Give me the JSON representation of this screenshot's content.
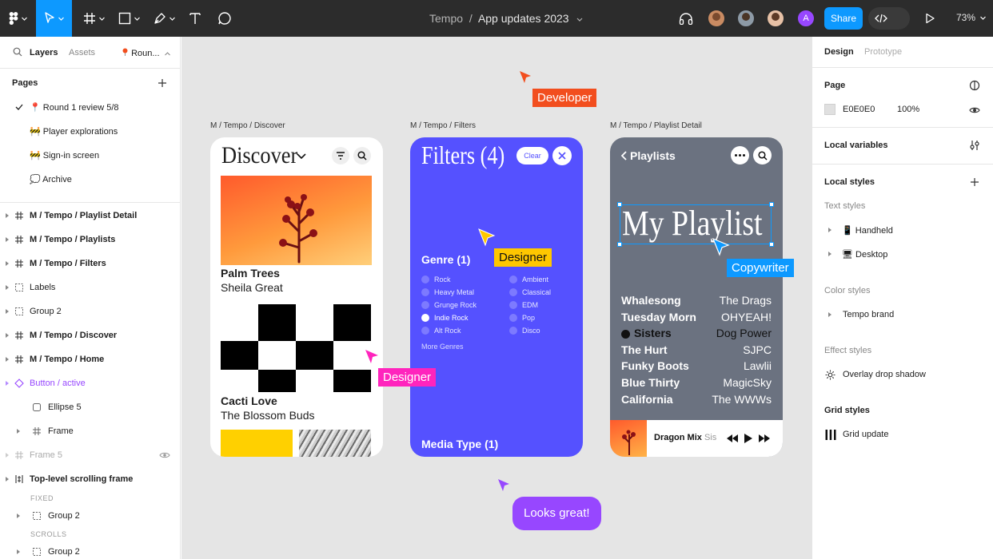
{
  "toolbar": {
    "file_name": "App updates 2023",
    "project": "Tempo",
    "separator": "/",
    "share_label": "Share",
    "zoom": "73%",
    "avatar_letter": "A"
  },
  "left_panel": {
    "tabs": [
      "Layers",
      "Assets",
      "Roun..."
    ],
    "pages_heading": "Pages",
    "pages": [
      "📍 Round 1 review 5/8",
      "🚧 Player explorations",
      "🚧 Sign-in screen",
      "💭 Archive"
    ],
    "layers": [
      "M / Tempo / Playlist Detail",
      "M / Tempo / Playlists",
      "M / Tempo / Filters",
      "Labels",
      "Group 2",
      "M / Tempo / Discover",
      "M / Tempo / Home",
      "Button / active",
      "Ellipse 5",
      "Frame",
      "Frame 5",
      "Top-level scrolling frame",
      "FIXED",
      "Group 2",
      "SCROLLS",
      "Group 2"
    ]
  },
  "canvas": {
    "frame_labels": [
      "M / Tempo / Discover",
      "M / Tempo / Filters",
      "M / Tempo / Playlist Detail"
    ],
    "discover": {
      "title": "Discover",
      "card1_title": "Palm Trees",
      "card1_artist": "Sheila Great",
      "card2_title": "Cacti Love",
      "card2_artist": "The Blossom Buds"
    },
    "filters": {
      "title": "Filters (4)",
      "clear": "Clear",
      "genre_heading": "Genre (1)",
      "genres_left": [
        "Rock",
        "Heavy Metal",
        "Grunge Rock",
        "Indie Rock",
        "Alt Rock"
      ],
      "genres_right": [
        "Ambient",
        "Classical",
        "EDM",
        "Pop",
        "Disco"
      ],
      "more": "More Genres",
      "media_type": "Media Type (1)"
    },
    "playlist": {
      "back": "Playlists",
      "title": "My Playlist",
      "tracks": [
        {
          "song": "Whalesong",
          "artist": "The Drags"
        },
        {
          "song": "Tuesday Morn",
          "artist": "OHYEAH!"
        },
        {
          "song": "Sisters",
          "artist": "Dog Power"
        },
        {
          "song": "The Hurt",
          "artist": "SJPC"
        },
        {
          "song": "Funky Boots",
          "artist": "Lawlii"
        },
        {
          "song": "Blue Thirty",
          "artist": "MagicSky"
        },
        {
          "song": "California",
          "artist": "The WWWs"
        }
      ],
      "now_playing": "Dragon Mix",
      "now_playing_sub": "Sist"
    },
    "cursors": {
      "developer": "Developer",
      "designer_a": "Designer",
      "designer_b": "Designer",
      "copywriter": "Copywriter",
      "comment": "Looks great!"
    }
  },
  "right_panel": {
    "tabs": [
      "Design",
      "Prototype"
    ],
    "page_heading": "Page",
    "page_color": "E0E0E0",
    "page_opacity": "100%",
    "local_variables": "Local variables",
    "local_styles": "Local styles",
    "text_styles": "Text styles",
    "text_style_items": [
      "📱 Handheld",
      "🖥 Desktop"
    ],
    "color_styles": "Color styles",
    "color_style_items": [
      "Tempo brand"
    ],
    "effect_styles": "Effect styles",
    "effect_style_items": [
      "Overlay drop shadow"
    ],
    "grid_styles": "Grid styles",
    "grid_style_items": [
      "Grid update"
    ]
  },
  "colors": {
    "toolbar_bg": "#2c2c2c",
    "accent_blue": "#0d99ff",
    "canvas_bg": "#e5e5e5",
    "filters_bg": "#5551ff",
    "playlist_bg": "#6b7280",
    "developer_tag": "#f24e1e",
    "designer_yellow": "#ffc700",
    "designer_pink": "#ff24bd",
    "copywriter_blue": "#0d99ff",
    "comment_purple": "#9747ff"
  }
}
